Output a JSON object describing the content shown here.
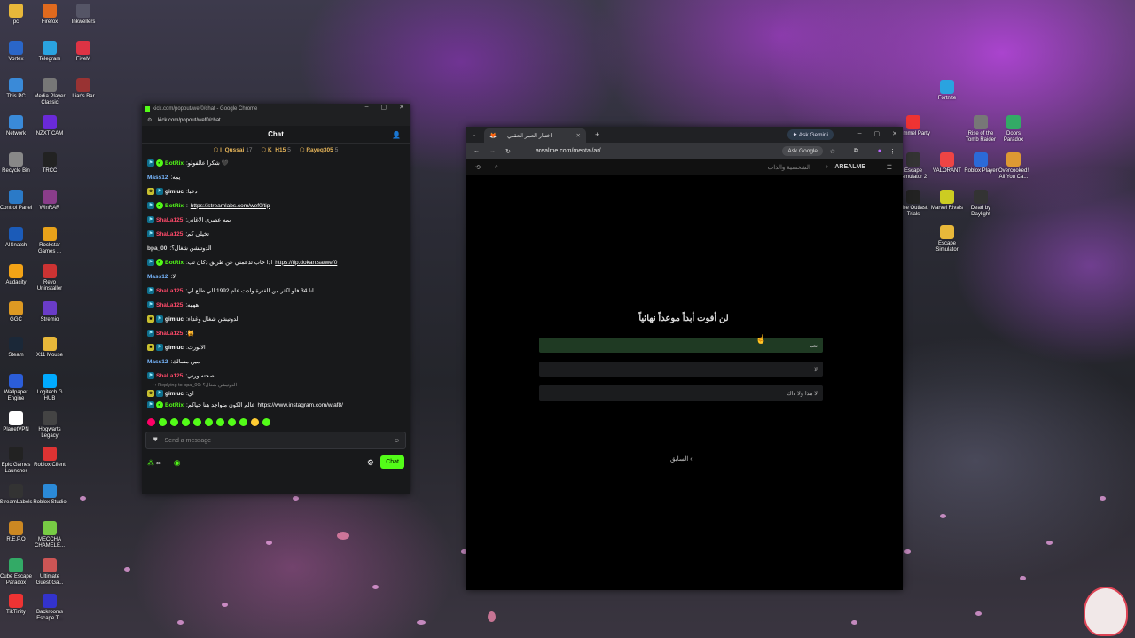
{
  "desktop": {
    "left_icons": [
      {
        "label": "pc",
        "color": "#e8b83a"
      },
      {
        "label": "Firefox",
        "color": "#e06a1e"
      },
      {
        "label": "Inkwellers",
        "color": "#556"
      },
      {
        "label": "Vortex",
        "color": "#2a66c8"
      },
      {
        "label": "Telegram",
        "color": "#2aa3e0"
      },
      {
        "label": "FiveM",
        "color": "#d34"
      },
      {
        "label": "This PC",
        "color": "#3a8ad8"
      },
      {
        "label": "Media Player Classic",
        "color": "#777"
      },
      {
        "label": "Liar's Bar",
        "color": "#933"
      },
      {
        "label": "Network",
        "color": "#3a8ad8"
      },
      {
        "label": "NZXT CAM",
        "color": "#6a2ad8"
      },
      {
        "label": "Recycle Bin",
        "color": "#888"
      },
      {
        "label": "TRCC",
        "color": "#222"
      },
      {
        "label": "Control Panel",
        "color": "#2b7ac7"
      },
      {
        "label": "WinRAR",
        "color": "#8a3d8a"
      },
      {
        "label": "AISnatch",
        "color": "#1b5bb8"
      },
      {
        "label": "Rockstar Games ...",
        "color": "#e8a21a"
      },
      {
        "label": "Audacity",
        "color": "#f3a316"
      },
      {
        "label": "Revo Uninstaller",
        "color": "#c33"
      },
      {
        "label": "GGC",
        "color": "#d92"
      },
      {
        "label": "Stremio",
        "color": "#6a3cc8"
      },
      {
        "label": "Steam",
        "color": "#1b2838"
      },
      {
        "label": "X11 Mouse",
        "color": "#e8b83a"
      },
      {
        "label": "Wallpaper Engine",
        "color": "#2b5dd8"
      },
      {
        "label": "Logitech G HUB",
        "color": "#0af"
      },
      {
        "label": "PlanetVPN",
        "color": "#fff"
      },
      {
        "label": "Hogwarts Legacy",
        "color": "#444"
      },
      {
        "label": "Epic Games Launcher",
        "color": "#222"
      },
      {
        "label": "Roblox Client",
        "color": "#d33"
      },
      {
        "label": "StreamLabels",
        "color": "#333"
      },
      {
        "label": "Roblox Studio",
        "color": "#2b8ad8"
      },
      {
        "label": "R.E.P.O",
        "color": "#c82"
      },
      {
        "label": "MECCHA CHAMELE...",
        "color": "#7c4"
      },
      {
        "label": "Cube Escape Paradox",
        "color": "#3a6"
      },
      {
        "label": "Ultimate Guest Ga...",
        "color": "#c55"
      },
      {
        "label": "TikTinity",
        "color": "#e33"
      },
      {
        "label": "Backrooms Escape T...",
        "color": "#33c"
      }
    ],
    "right_icons": [
      {
        "label": "Fortnite",
        "color": "#2aa3e0"
      },
      {
        "label": "Pummel Party",
        "color": "#e33"
      },
      {
        "label": "Rise of the Tomb Raider",
        "color": "#777"
      },
      {
        "label": "Doors Paradox",
        "color": "#3a6"
      },
      {
        "label": "Escape Simulator 2",
        "color": "#333"
      },
      {
        "label": "VALORANT",
        "color": "#e44"
      },
      {
        "label": "Roblox Player",
        "color": "#2b6ad8"
      },
      {
        "label": "Overcooked! All You Ca...",
        "color": "#d93"
      },
      {
        "label": "The Outlast Trials",
        "color": "#222"
      },
      {
        "label": "Marvel Rivals",
        "color": "#cc2"
      },
      {
        "label": "Dead by Daylight",
        "color": "#333"
      },
      {
        "label": "Escape Simulator",
        "color": "#e8b83a"
      }
    ]
  },
  "chat_window": {
    "title": "kick.com/popout/wef0/chat - Google Chrome",
    "url": "kick.com/popout/wef0/chat",
    "header": "Chat",
    "leaders": [
      {
        "name": "l_Qussai",
        "count": "17"
      },
      {
        "name": "K_H15",
        "count": "5"
      },
      {
        "name": "Rayeq305",
        "count": "5"
      }
    ],
    "messages": [
      {
        "user": "BotRix",
        "color": "#53fc18",
        "text": "شكرا عالفولو 🖤",
        "link": "",
        "badges": [
          "bot",
          "ver"
        ]
      },
      {
        "user": "Mass12",
        "color": "#79b8ff",
        "text": "يمه",
        "link": "",
        "badges": []
      },
      {
        "user": "gimluc",
        "color": "#fff",
        "text": "دعبا",
        "link": "",
        "badges": [
          "sub",
          "bot"
        ]
      },
      {
        "user": "BotRix",
        "color": "#53fc18",
        "text": "",
        "link": "https://streamlabs.com/wef0/tip",
        "badges": [
          "bot",
          "ver"
        ]
      },
      {
        "user": "ShaLa125",
        "color": "#ff4a6a",
        "text": "يمه عصري الاغاني",
        "link": "",
        "badges": [
          "bot"
        ]
      },
      {
        "user": "ShaLa125",
        "color": "#ff4a6a",
        "text": "تخيلي كم",
        "link": "",
        "badges": [
          "bot"
        ]
      },
      {
        "user": "bpa_00",
        "color": "#ddd",
        "text": "الدوتيشن شغال؟",
        "link": "",
        "badges": []
      },
      {
        "user": "BotRix",
        "color": "#53fc18",
        "text": "اذا حاب تدعمني عن طريق دكان تب",
        "link": "https://tip.dokan.sa/wef0",
        "badges": [
          "bot",
          "ver"
        ]
      },
      {
        "user": "Mass12",
        "color": "#79b8ff",
        "text": "لا",
        "link": "",
        "badges": []
      },
      {
        "user": "ShaLa125",
        "color": "#ff4a6a",
        "text": "انا 34 فلو اكثر من الفترة ولدت عام 1992 الي طلع لي",
        "link": "",
        "badges": [
          "bot"
        ]
      },
      {
        "user": "ShaLa125",
        "color": "#ff4a6a",
        "text": "هههه",
        "link": "",
        "badges": [
          "bot"
        ]
      },
      {
        "user": "gimluc",
        "color": "#fff",
        "text": "الدوتيشن شغال وغداء",
        "link": "",
        "badges": [
          "sub",
          "bot"
        ]
      },
      {
        "user": "ShaLa125",
        "color": "#ff4a6a",
        "text": "🙀",
        "link": "",
        "badges": [
          "bot"
        ]
      },
      {
        "user": "gimluc",
        "color": "#fff",
        "text": "الانورت",
        "link": "",
        "badges": [
          "sub",
          "bot"
        ]
      },
      {
        "user": "Mass12",
        "color": "#79b8ff",
        "text": "مين مسالك",
        "link": "",
        "badges": []
      },
      {
        "user": "ShaLa125",
        "color": "#ff4a6a",
        "text": "صحته ورني",
        "link": "",
        "badges": [
          "bot"
        ]
      },
      {
        "user": "gimluc",
        "color": "#fff",
        "text": "اي",
        "link": "",
        "badges": [
          "sub",
          "bot"
        ]
      },
      {
        "user": "BotRix",
        "color": "#53fc18",
        "text": "عالم الكون متواجد هنا حياكم",
        "link": "https://www.instagram.com/w.af8/",
        "badges": [
          "bot",
          "ver"
        ]
      }
    ],
    "reply_note": "↪ Replying to bpa_00: الدوتيشن شغال؟",
    "input_placeholder": "Send a message",
    "chat_button": "Chat",
    "footer_count": "∞"
  },
  "browser": {
    "tab_title": "اختبار العمر العقلي",
    "gemini": "Ask Gemini",
    "url": "arealme.com/mental/ar/",
    "ask_google": "Ask Google",
    "brand": "AREALME",
    "breadcrumb": "الشخصية والذات",
    "question": "لن أفوت أبداً موعداً نهائياً",
    "options": [
      "نعم",
      "لا",
      "لا هذا ولا ذاك"
    ],
    "prev": "السابق",
    "accent": "#1f3a23"
  }
}
